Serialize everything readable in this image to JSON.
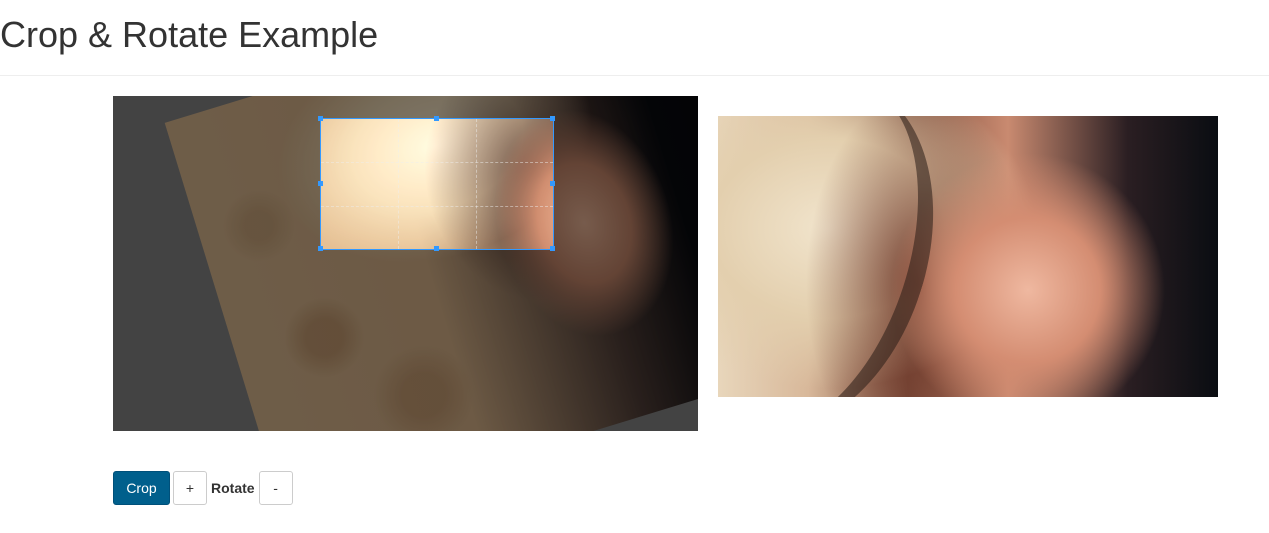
{
  "page": {
    "title": "Crop & Rotate Example"
  },
  "editor": {
    "image_subject": "portrait-photo",
    "rotation_direction": "counter-clockwise",
    "crop_handles": [
      "nw",
      "n",
      "ne",
      "e",
      "se",
      "s",
      "sw",
      "w"
    ]
  },
  "preview": {
    "image_subject": "cropped-portrait-preview"
  },
  "controls": {
    "crop_label": "Crop",
    "rotate_plus_label": "+",
    "rotate_label": "Rotate",
    "rotate_minus_label": "-"
  },
  "colors": {
    "primary_button": "#005f8c",
    "crop_outline": "#3399ff",
    "dim_overlay": "#7a7a7a"
  }
}
